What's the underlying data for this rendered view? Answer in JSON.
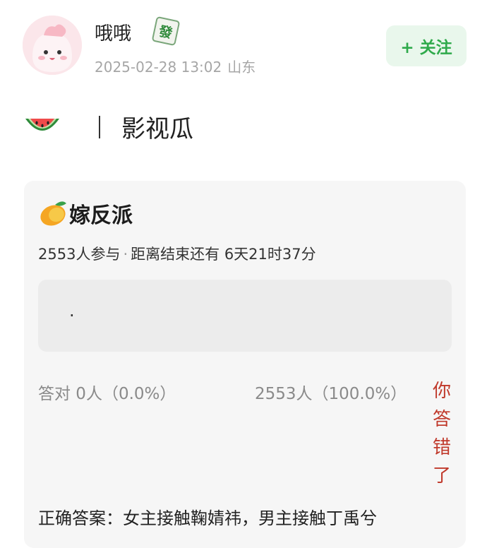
{
  "post": {
    "username": "哦哦",
    "badge_icon": "mahjong-fa-tile-icon",
    "badge_glyph": "發",
    "timestamp": "2025-02-28 13:02",
    "location": "山东",
    "follow_label": "+ 关注"
  },
  "topic": {
    "icon": "watermelon-icon",
    "label": "影视瓜"
  },
  "quiz": {
    "icon": "mango-icon",
    "title": "嫁反派",
    "participants": "2553人参与",
    "separator": "·",
    "countdown": "距离结束还有 6天21时37分",
    "answer_text": ".",
    "correct_stat": "答对  0人（0.0%）",
    "wrong_stat": "2553人（100.0%）",
    "verdict_chars": [
      "你",
      "答",
      "错",
      "了"
    ],
    "explanation": "正确答案：女主接触鞠婧祎，男主接触丁禹兮"
  },
  "colors": {
    "follow_bg": "#e9f7ec",
    "follow_text": "#2faa4b",
    "verdict": "#c0392b",
    "card_bg": "#f6f6f6"
  }
}
